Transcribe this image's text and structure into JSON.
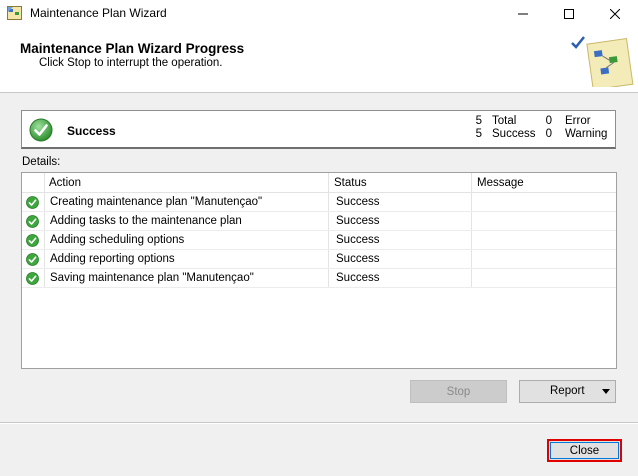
{
  "window": {
    "title": "Maintenance Plan Wizard",
    "icon": "wizard-app-icon"
  },
  "header": {
    "title": "Maintenance Plan Wizard Progress",
    "subtitle": "Click Stop to interrupt the operation."
  },
  "status": {
    "label": "Success",
    "total_count": "5",
    "total_label": "Total",
    "success_count": "5",
    "success_label": "Success",
    "error_count": "0",
    "error_label": "Error",
    "warning_count": "0",
    "warning_label": "Warning"
  },
  "details": {
    "label": "Details:",
    "columns": [
      "Action",
      "Status",
      "Message"
    ],
    "rows": [
      {
        "action": "Creating maintenance plan \"Manutençao\"",
        "status": "Success",
        "message": ""
      },
      {
        "action": "Adding tasks to the maintenance plan",
        "status": "Success",
        "message": ""
      },
      {
        "action": "Adding scheduling options",
        "status": "Success",
        "message": ""
      },
      {
        "action": "Adding reporting options",
        "status": "Success",
        "message": ""
      },
      {
        "action": "Saving maintenance plan \"Manutençao\"",
        "status": "Success",
        "message": ""
      }
    ]
  },
  "buttons": {
    "stop": "Stop",
    "report": "Report",
    "close": "Close"
  },
  "colors": {
    "success_green": "#3da63d",
    "close_highlight": "#e00000",
    "focus_blue": "#0078d7"
  }
}
